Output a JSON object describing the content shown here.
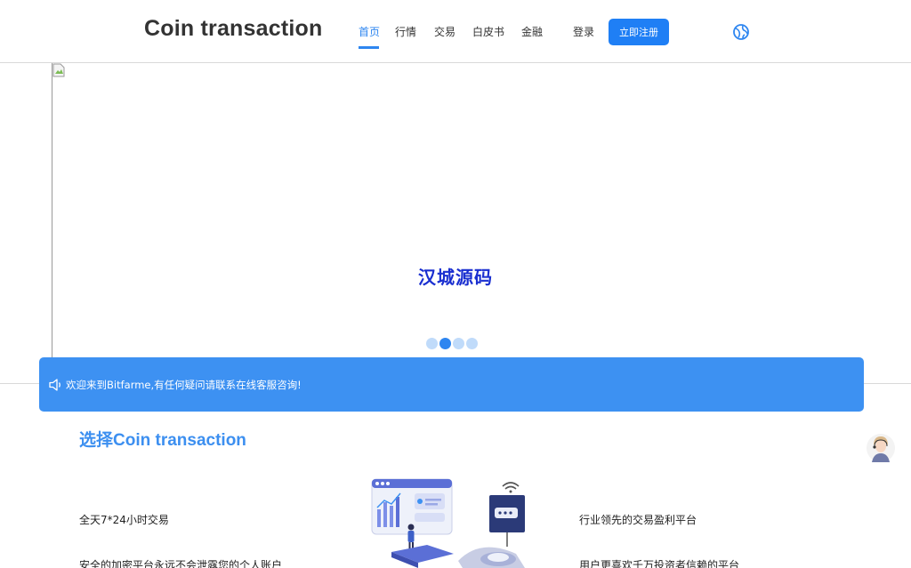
{
  "header": {
    "brand": "Coin transaction",
    "nav": [
      {
        "label": "首页",
        "active": true
      },
      {
        "label": "行情"
      },
      {
        "label": "交易"
      },
      {
        "label": "白皮书"
      },
      {
        "label": "金融"
      }
    ],
    "login": "登录",
    "register": "立即注册",
    "language_icon": "globe-icon"
  },
  "banner": {
    "watermark": "汉城源码",
    "slides_count": 4,
    "active_slide": 2
  },
  "notice": {
    "icon": "speaker-icon",
    "text": "欢迎来到Bitfarme,有任何疑问请联系在线客服咨询!"
  },
  "choose": {
    "title": "选择Coin transaction",
    "features_left": [
      "全天7*24小时交易",
      "安全的加密平台永远不会泄露您的个人账户"
    ],
    "features_right": [
      "行业领先的交易盈利平台",
      "用户更喜欢千万投资者信赖的平台"
    ]
  },
  "support": {
    "icon": "customer-service-avatar-icon"
  },
  "colors": {
    "accent": "#2e86f0",
    "notice_bg": "#3d91f2",
    "watermark": "#1a2fd0"
  }
}
